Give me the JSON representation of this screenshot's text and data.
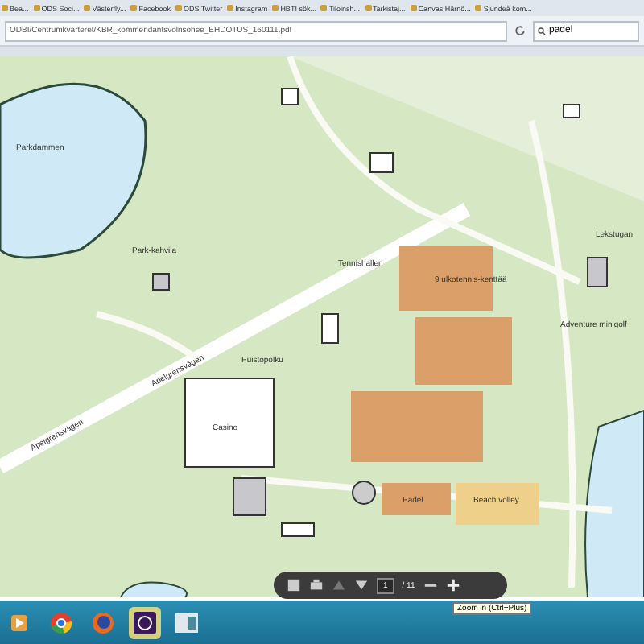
{
  "bookmarks": [
    {
      "label": "Bea..."
    },
    {
      "label": "ODS Soci..."
    },
    {
      "label": "Västerfly..."
    },
    {
      "label": "Facebook"
    },
    {
      "label": "ODS Twitter"
    },
    {
      "label": "Instagram"
    },
    {
      "label": "HBTI sök..."
    },
    {
      "label": "Tiloinsh..."
    },
    {
      "label": "Tarkistaj..."
    },
    {
      "label": "Canvas Härnö..."
    },
    {
      "label": "Sjundeå kom..."
    }
  ],
  "address_bar": {
    "value": "ODBI/Centrumkvarteret/KBR_kommendantsvolnsohee_EHDOTUS_160111.pdf"
  },
  "search": {
    "value": "padel"
  },
  "map": {
    "labels": [
      "Parkdammen",
      "Park-kahvila",
      "Apelgrensvägen",
      "Apelgrensvägen",
      "Casino",
      "Puistopolku",
      "Tennishallen",
      "9 ulkotennis-kenttää",
      "Lekstugan",
      "Adventure minigolf",
      "Padel",
      "Beach volley"
    ]
  },
  "pdf_toolbar": {
    "page": "1",
    "page_count": "/ 11",
    "tooltip": "Zoom in (Ctrl+Plus)"
  }
}
